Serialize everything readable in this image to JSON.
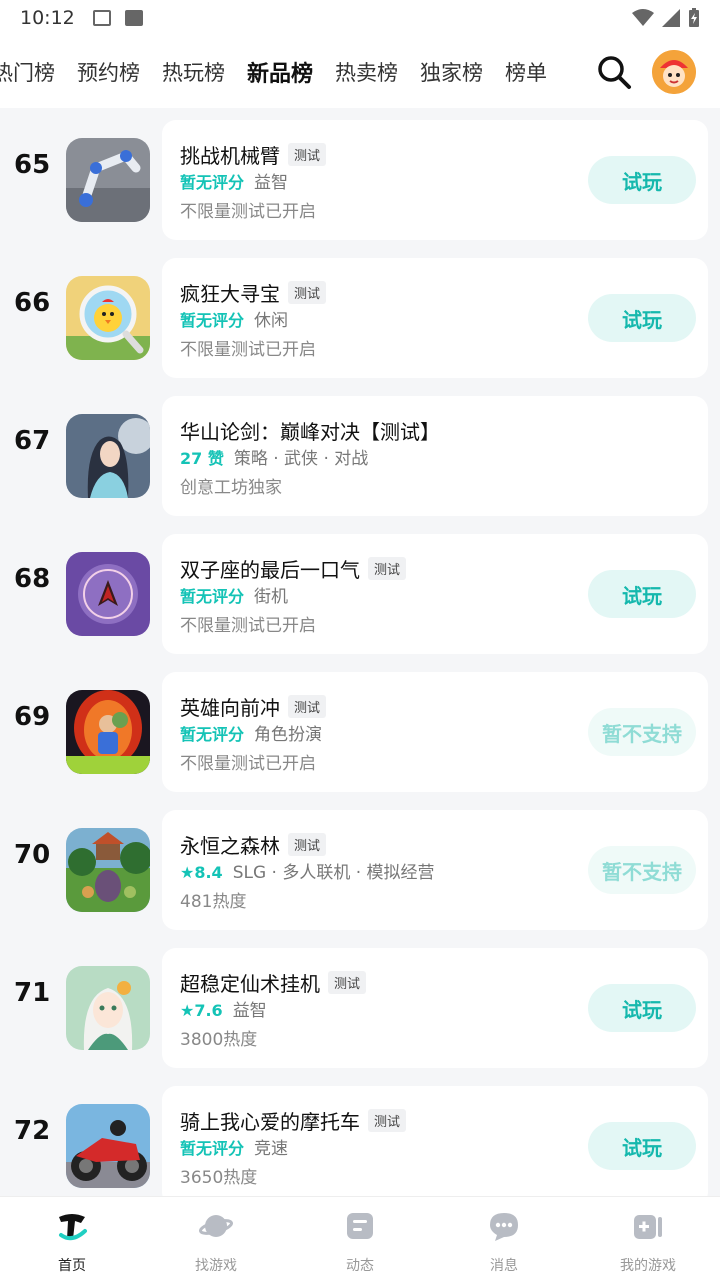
{
  "status_bar": {
    "time": "10:12"
  },
  "tabs": [
    "热门榜",
    "预约榜",
    "热玩榜",
    "新品榜",
    "热卖榜",
    "独家榜",
    "榜单"
  ],
  "active_tab": "新品榜",
  "games": [
    {
      "rank": "65",
      "title": "挑战机械臂",
      "tag": "测试",
      "score": "暂无评分",
      "category": "益智",
      "sub": "不限量测试已开启",
      "button": "试玩",
      "button_enabled": true
    },
    {
      "rank": "66",
      "title": "疯狂大寻宝",
      "tag": "测试",
      "score": "暂无评分",
      "category": "休闲",
      "sub": "不限量测试已开启",
      "button": "试玩",
      "button_enabled": true
    },
    {
      "rank": "67",
      "title": "华山论剑：巅峰对决【测试】",
      "tag": "",
      "score": "27 赞",
      "category": "策略 · 武侠 · 对战",
      "sub": "创意工坊独家",
      "button": "",
      "button_enabled": false
    },
    {
      "rank": "68",
      "title": "双子座的最后一口气",
      "tag": "测试",
      "score": "暂无评分",
      "category": "街机",
      "sub": "不限量测试已开启",
      "button": "试玩",
      "button_enabled": true
    },
    {
      "rank": "69",
      "title": "英雄向前冲",
      "tag": "测试",
      "score": "暂无评分",
      "category": "角色扮演",
      "sub": "不限量测试已开启",
      "button": "暂不支持",
      "button_enabled": false
    },
    {
      "rank": "70",
      "title": "永恒之森林",
      "tag": "测试",
      "score": "★8.4",
      "category": "SLG · 多人联机 · 模拟经营",
      "sub": "481热度",
      "button": "暂不支持",
      "button_enabled": false
    },
    {
      "rank": "71",
      "title": "超稳定仙术挂机",
      "tag": "测试",
      "score": "★7.6",
      "category": "益智",
      "sub": "3800热度",
      "button": "试玩",
      "button_enabled": true
    },
    {
      "rank": "72",
      "title": "骑上我心爱的摩托车",
      "tag": "测试",
      "score": "暂无评分",
      "category": "竞速",
      "sub": "3650热度",
      "button": "试玩",
      "button_enabled": true
    }
  ],
  "bottom_nav": [
    {
      "label": "首页",
      "icon": "home-icon"
    },
    {
      "label": "找游戏",
      "icon": "planet-icon"
    },
    {
      "label": "动态",
      "icon": "feed-icon"
    },
    {
      "label": "消息",
      "icon": "chat-icon"
    },
    {
      "label": "我的游戏",
      "icon": "gamepad-icon"
    }
  ],
  "colors": {
    "accent": "#14c3b6",
    "button_bg": "#e3f7f5"
  }
}
